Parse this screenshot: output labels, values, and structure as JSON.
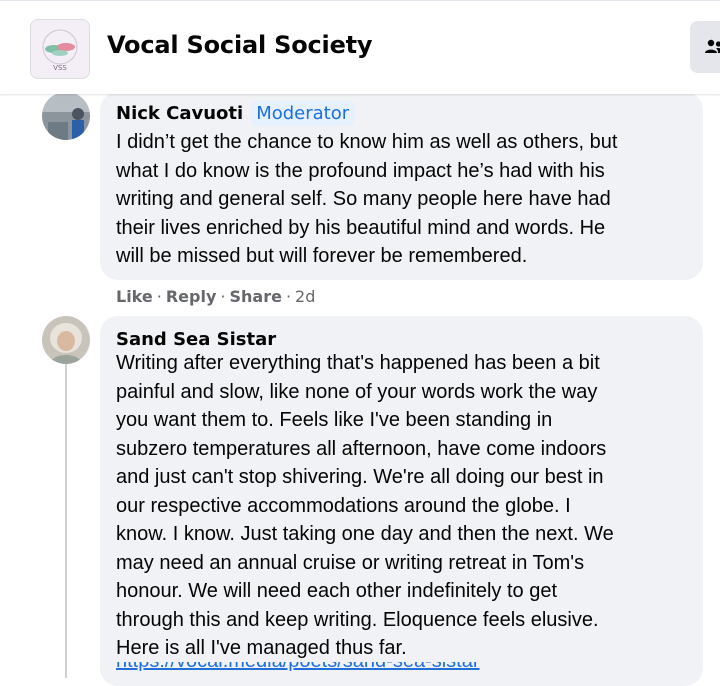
{
  "header": {
    "group_name": "Vocal Social Society",
    "logo_text": "VSS",
    "members_icon": "members-icon"
  },
  "comments": [
    {
      "author": "Nick Cavuoti",
      "badge": "Moderator",
      "lines": [
        "I didn’t get the chance to know him as well as others, but",
        "what I do know is the profound impact he’s had with his",
        "writing and general self. So many people here have had",
        "their lives enriched by his beautiful mind and words. He",
        "will be missed but will forever be remembered."
      ],
      "actions": {
        "like": "Like",
        "reply": "Reply",
        "share": "Share",
        "time": "2d"
      }
    },
    {
      "author": "Sand Sea Sistar",
      "lines": [
        "Writing after everything that's happened has been a bit",
        "painful and slow, like none of your words work the way",
        "you want them to. Feels like I've been standing in",
        "subzero temperatures all afternoon, have come indoors",
        "and just can't stop shivering. We're all doing our best in",
        "our respective accommodations around the globe. I",
        "know. I know. Just taking one day and then the next. We",
        "may need an annual cruise or writing retreat in Tom's",
        "honour. We will need each other indefinitely to get",
        "through this and keep writing. Eloquence feels elusive.",
        "Here is all I've managed thus far."
      ],
      "link_partial": "https://vocal.media/poets/sand-sea-sistar"
    }
  ],
  "colors": {
    "bubble": "#f0f2f5",
    "moderator_badge_bg": "#e7f0fd",
    "moderator_badge_text": "#1b6fe0",
    "meta_text": "#65676b",
    "link": "#216fdb"
  }
}
